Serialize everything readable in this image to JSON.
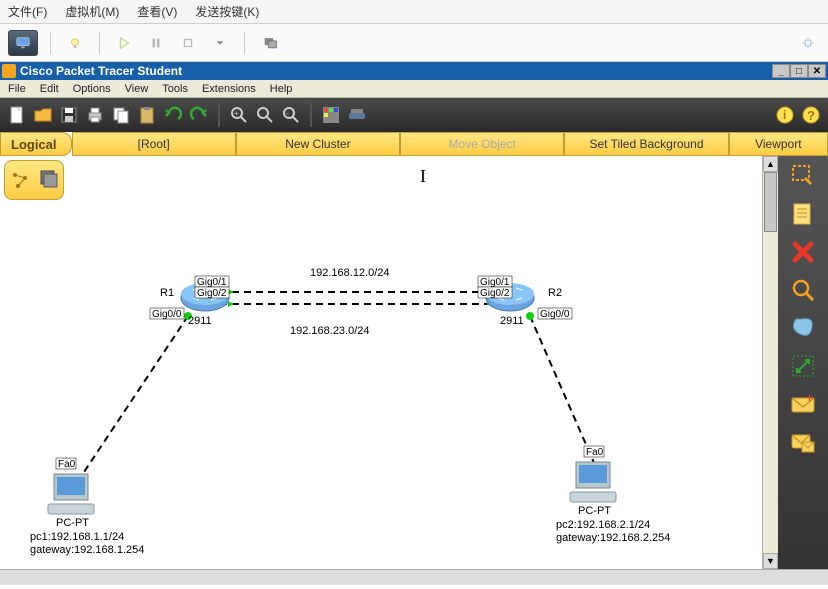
{
  "vm_menu": {
    "file": "文件(F)",
    "vm": "虚拟机(M)",
    "view": "查看(V)",
    "send": "发送按键(K)"
  },
  "app": {
    "title": "Cisco Packet Tracer Student",
    "menu": {
      "file": "File",
      "edit": "Edit",
      "options": "Options",
      "view": "View",
      "tools": "Tools",
      "extensions": "Extensions",
      "help": "Help"
    }
  },
  "yellowbar": {
    "logical": "Logical",
    "root": "[Root]",
    "newcluster": "New Cluster",
    "moveobj": "Move Object",
    "setbg": "Set Tiled Background",
    "viewport": "Viewport"
  },
  "nodes": {
    "r1": {
      "label": "R1",
      "model": "2911",
      "ports": {
        "g00": "Gig0/0",
        "g01": "Gig0/1",
        "g02": "Gig0/2"
      }
    },
    "r2": {
      "label": "R2",
      "model": "2911",
      "ports": {
        "g00": "Gig0/0",
        "g01": "Gig0/1",
        "g02": "Gig0/2"
      }
    },
    "pc1": {
      "label": "PC-PT",
      "port": "Fa0",
      "line1": "pc1:192.168.1.1/24",
      "line2": "gateway:192.168.1.254"
    },
    "pc2": {
      "label": "PC-PT",
      "port": "Fa0",
      "line1": "pc2:192.168.2.1/24",
      "line2": "gateway:192.168.2.254"
    }
  },
  "links": {
    "net12": "192.168.12.0/24",
    "net23": "192.168.23.0/24"
  }
}
